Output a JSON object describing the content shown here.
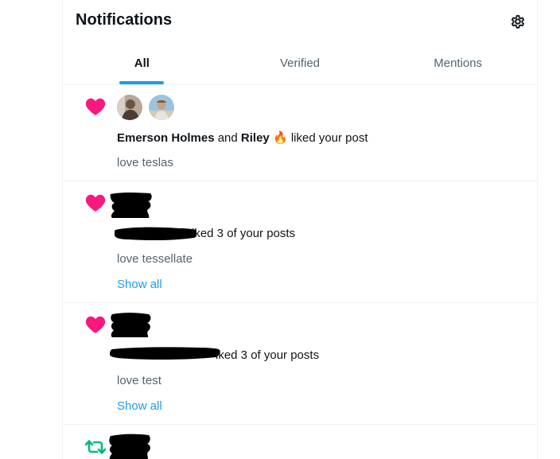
{
  "header": {
    "title": "Notifications"
  },
  "tabs": [
    {
      "label": "All",
      "active": true
    },
    {
      "label": "Verified",
      "active": false
    },
    {
      "label": "Mentions",
      "active": false
    }
  ],
  "notifications": [
    {
      "type": "like",
      "icon": "heart-icon",
      "user1": "Emerson Holmes",
      "joiner": "and",
      "user2": "Riley",
      "emoji": "🔥",
      "action": "liked your post",
      "snippet": "love teslas"
    },
    {
      "type": "like",
      "icon": "heart-icon",
      "action": "iked 3 of your posts",
      "snippet": "love tessellate",
      "show_all": "Show all"
    },
    {
      "type": "like",
      "icon": "heart-icon",
      "action": "iked 3 of your posts",
      "snippet": "love test",
      "show_all": "Show all"
    },
    {
      "type": "repost",
      "icon": "repost-icon"
    }
  ],
  "colors": {
    "accent": "#1d9bf0",
    "like": "#f91880",
    "repost": "#00ba7c"
  }
}
